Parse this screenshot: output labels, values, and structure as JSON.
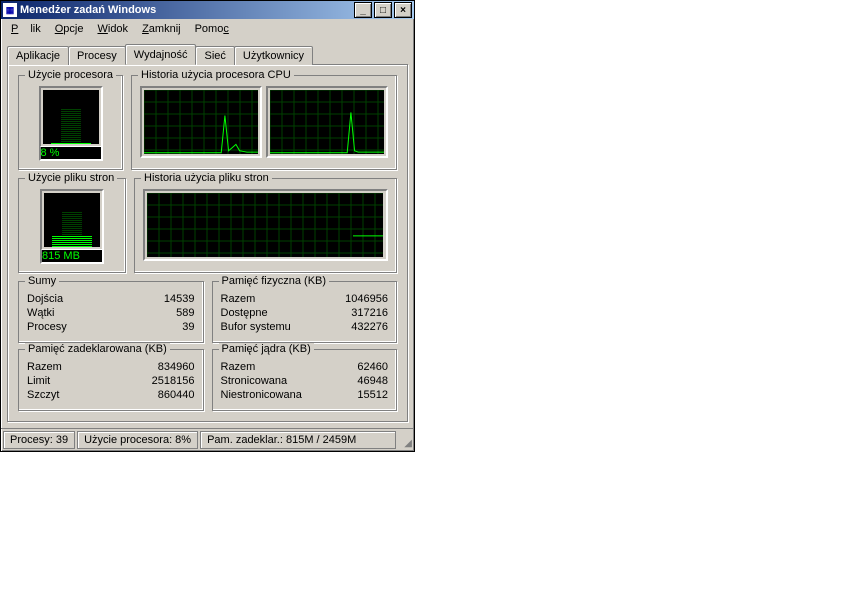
{
  "title": "Menedżer zadań Windows",
  "menu": [
    "Plik",
    "Opcje",
    "Widok",
    "Zamknij",
    "Pomoc"
  ],
  "tabs": [
    "Aplikacje",
    "Procesy",
    "Wydajność",
    "Sieć",
    "Użytkownicy"
  ],
  "active_tab": 2,
  "cpu_usage_label": "Użycie procesora",
  "cpu_history_label": "Historia użycia procesora CPU",
  "pf_usage_label": "Użycie pliku stron",
  "pf_history_label": "Historia użycia pliku stron",
  "cpu_value": "8 %",
  "pf_value": "815 MB",
  "box_totals": {
    "title": "Sumy",
    "rows": [
      {
        "k": "Dojścia",
        "v": "14539"
      },
      {
        "k": "Wątki",
        "v": "589"
      },
      {
        "k": "Procesy",
        "v": "39"
      }
    ]
  },
  "box_phys": {
    "title": "Pamięć fizyczna (KB)",
    "rows": [
      {
        "k": "Razem",
        "v": "1046956"
      },
      {
        "k": "Dostępne",
        "v": "317216"
      },
      {
        "k": "Bufor systemu",
        "v": "432276"
      }
    ]
  },
  "box_commit": {
    "title": "Pamięć zadeklarowana (KB)",
    "rows": [
      {
        "k": "Razem",
        "v": "834960"
      },
      {
        "k": "Limit",
        "v": "2518156"
      },
      {
        "k": "Szczyt",
        "v": "860440"
      }
    ]
  },
  "box_kernel": {
    "title": "Pamięć jądra (KB)",
    "rows": [
      {
        "k": "Razem",
        "v": "62460"
      },
      {
        "k": "Stronicowana",
        "v": "46948"
      },
      {
        "k": "Niestronicowana",
        "v": "15512"
      }
    ]
  },
  "status": {
    "procs": "Procesy: 39",
    "cpu": "Użycie procesora: 8%",
    "commit": "Pam. zadeklar.: 815M / 2459M"
  },
  "chart_data": {
    "cpu_gauge_pct": 8,
    "pf_gauge_pct": 33,
    "cpu_history": {
      "type": "line",
      "ylim": [
        0,
        100
      ],
      "series": [
        {
          "name": "CPU0",
          "values": [
            2,
            2,
            2,
            2,
            2,
            2,
            2,
            2,
            2,
            2,
            2,
            2,
            2,
            2,
            2,
            2,
            2,
            2,
            2,
            2,
            2,
            2,
            60,
            5,
            10,
            15,
            5,
            4,
            3,
            3,
            3,
            3
          ]
        },
        {
          "name": "CPU1",
          "values": [
            2,
            2,
            2,
            2,
            2,
            2,
            2,
            2,
            2,
            2,
            2,
            2,
            2,
            2,
            2,
            2,
            2,
            2,
            2,
            2,
            2,
            2,
            65,
            5,
            3,
            3,
            3,
            3,
            3,
            3,
            3,
            3
          ]
        }
      ]
    },
    "pf_history": {
      "type": "line",
      "ylim": [
        0,
        100
      ],
      "series": [
        {
          "name": "PF",
          "values": [
            33,
            33,
            33,
            33,
            33,
            33,
            33,
            33,
            33,
            33,
            33,
            33,
            33,
            33,
            33,
            33,
            33,
            33,
            33,
            33,
            33,
            33,
            33,
            33,
            33,
            33,
            33,
            33,
            33,
            33,
            33,
            33
          ]
        }
      ]
    }
  }
}
